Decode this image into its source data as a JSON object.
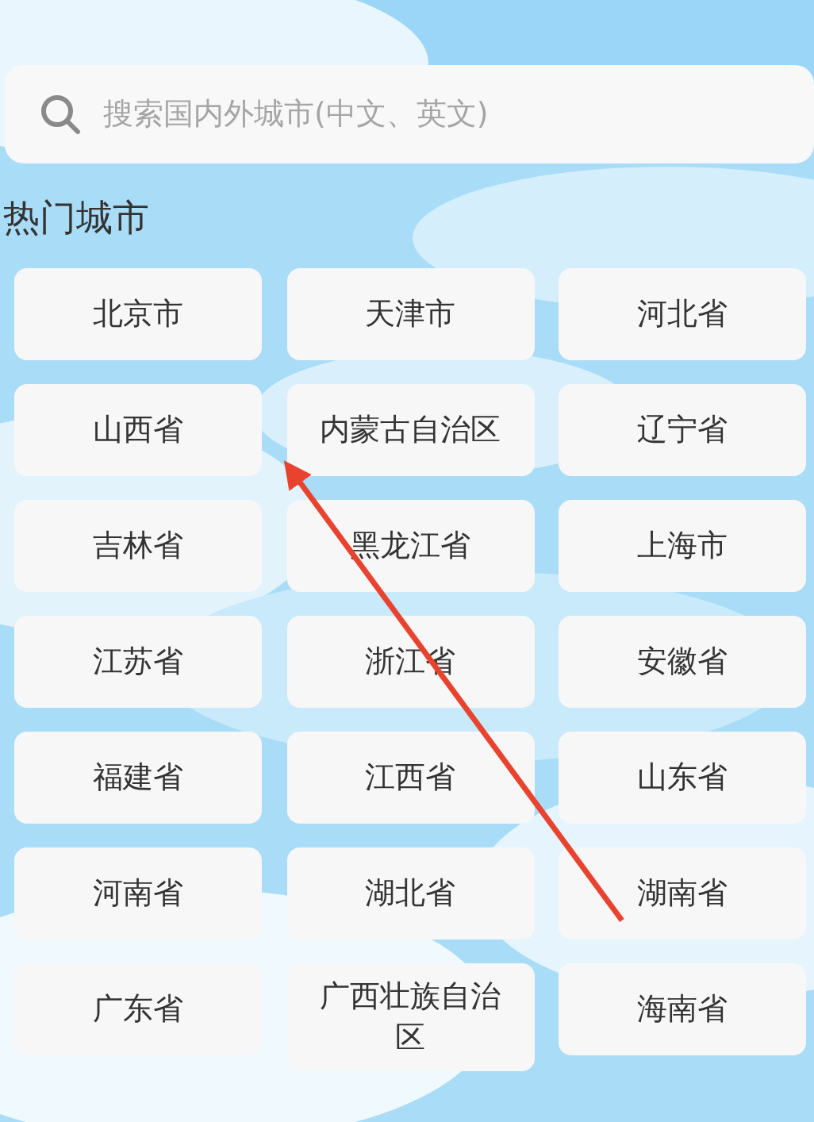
{
  "search": {
    "placeholder": "搜索国内外城市(中文、英文)"
  },
  "section_title": "热门城市",
  "cities": [
    "北京市",
    "天津市",
    "河北省",
    "山西省",
    "内蒙古自治区",
    "辽宁省",
    "吉林省",
    "黑龙江省",
    "上海市",
    "江苏省",
    "浙江省",
    "安徽省",
    "福建省",
    "江西省",
    "山东省",
    "河南省",
    "湖北省",
    "湖南省",
    "广东省",
    "广西壮族自治区",
    "海南省"
  ]
}
